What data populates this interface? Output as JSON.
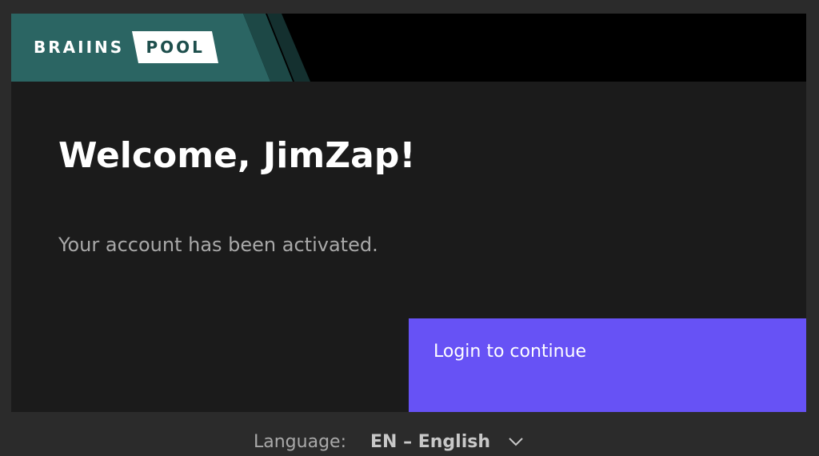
{
  "header": {
    "logo_word": "BRAIINS",
    "logo_tag": "POOL"
  },
  "main": {
    "title": "Welcome, JimZap!",
    "message": "Your account has been activated."
  },
  "actions": {
    "login_label": "Login to continue"
  },
  "footer": {
    "language_label": "Language:",
    "language_value": "EN – English"
  },
  "icons": {
    "language_dropdown": "chevron-down-icon"
  },
  "colors": {
    "brand_teal": "#2b6563",
    "header_bg": "#000000",
    "card_bg": "#1b1b1b",
    "page_bg": "#2b2b2b",
    "button_bg": "#6752f5"
  }
}
